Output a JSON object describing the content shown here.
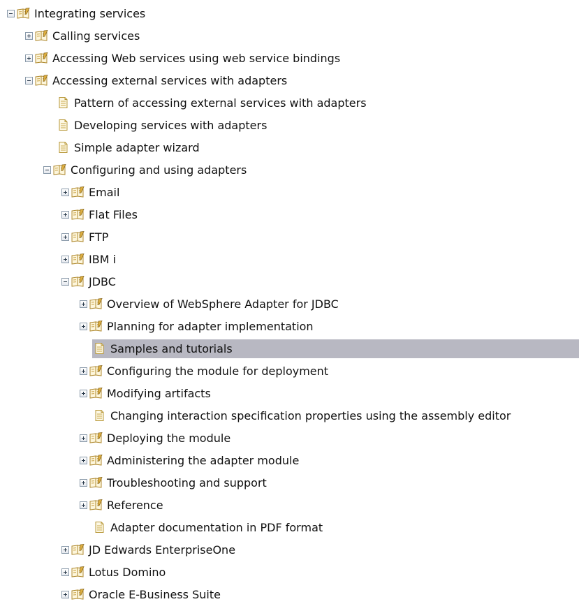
{
  "tree": {
    "items": [
      {
        "label": "Integrating services",
        "level": 0,
        "kind": "book",
        "state": "expanded"
      },
      {
        "label": "Calling services",
        "level": 1,
        "kind": "book",
        "state": "collapsed"
      },
      {
        "label": "Accessing Web services using web service bindings",
        "level": 1,
        "kind": "book",
        "state": "collapsed"
      },
      {
        "label": "Accessing external services with adapters",
        "level": 1,
        "kind": "book",
        "state": "expanded"
      },
      {
        "label": "Pattern of accessing external services with adapters",
        "level": 2,
        "kind": "page"
      },
      {
        "label": "Developing services with adapters",
        "level": 2,
        "kind": "page"
      },
      {
        "label": "Simple adapter wizard",
        "level": 2,
        "kind": "page"
      },
      {
        "label": "Configuring and using adapters",
        "level": 2,
        "kind": "book",
        "state": "expanded"
      },
      {
        "label": "Email",
        "level": 3,
        "kind": "book",
        "state": "collapsed"
      },
      {
        "label": "Flat Files",
        "level": 3,
        "kind": "book",
        "state": "collapsed"
      },
      {
        "label": "FTP",
        "level": 3,
        "kind": "book",
        "state": "collapsed"
      },
      {
        "label": "IBM i",
        "level": 3,
        "kind": "book",
        "state": "collapsed"
      },
      {
        "label": "JDBC",
        "level": 3,
        "kind": "book",
        "state": "expanded"
      },
      {
        "label": "Overview of WebSphere Adapter for JDBC",
        "level": 4,
        "kind": "book",
        "state": "collapsed"
      },
      {
        "label": "Planning for adapter implementation",
        "level": 4,
        "kind": "book",
        "state": "collapsed"
      },
      {
        "label": "Samples and tutorials",
        "level": 4,
        "kind": "page",
        "selected": true
      },
      {
        "label": "Configuring the module for deployment",
        "level": 4,
        "kind": "book",
        "state": "collapsed"
      },
      {
        "label": "Modifying artifacts",
        "level": 4,
        "kind": "book",
        "state": "collapsed"
      },
      {
        "label": "Changing interaction specification properties using the assembly editor",
        "level": 4,
        "kind": "page"
      },
      {
        "label": "Deploying the module",
        "level": 4,
        "kind": "book",
        "state": "collapsed"
      },
      {
        "label": "Administering the adapter module",
        "level": 4,
        "kind": "book",
        "state": "collapsed"
      },
      {
        "label": "Troubleshooting and support",
        "level": 4,
        "kind": "book",
        "state": "collapsed"
      },
      {
        "label": "Reference",
        "level": 4,
        "kind": "book",
        "state": "collapsed"
      },
      {
        "label": "Adapter documentation in PDF format",
        "level": 4,
        "kind": "page"
      },
      {
        "label": "JD Edwards EnterpriseOne",
        "level": 3,
        "kind": "book",
        "state": "collapsed"
      },
      {
        "label": "Lotus Domino",
        "level": 3,
        "kind": "book",
        "state": "collapsed"
      },
      {
        "label": "Oracle E-Business Suite",
        "level": 3,
        "kind": "book",
        "state": "collapsed"
      }
    ]
  },
  "colors": {
    "selection": "#b8b8c2",
    "book_icon": "#c8a040",
    "page_icon": "#c9a94a"
  }
}
